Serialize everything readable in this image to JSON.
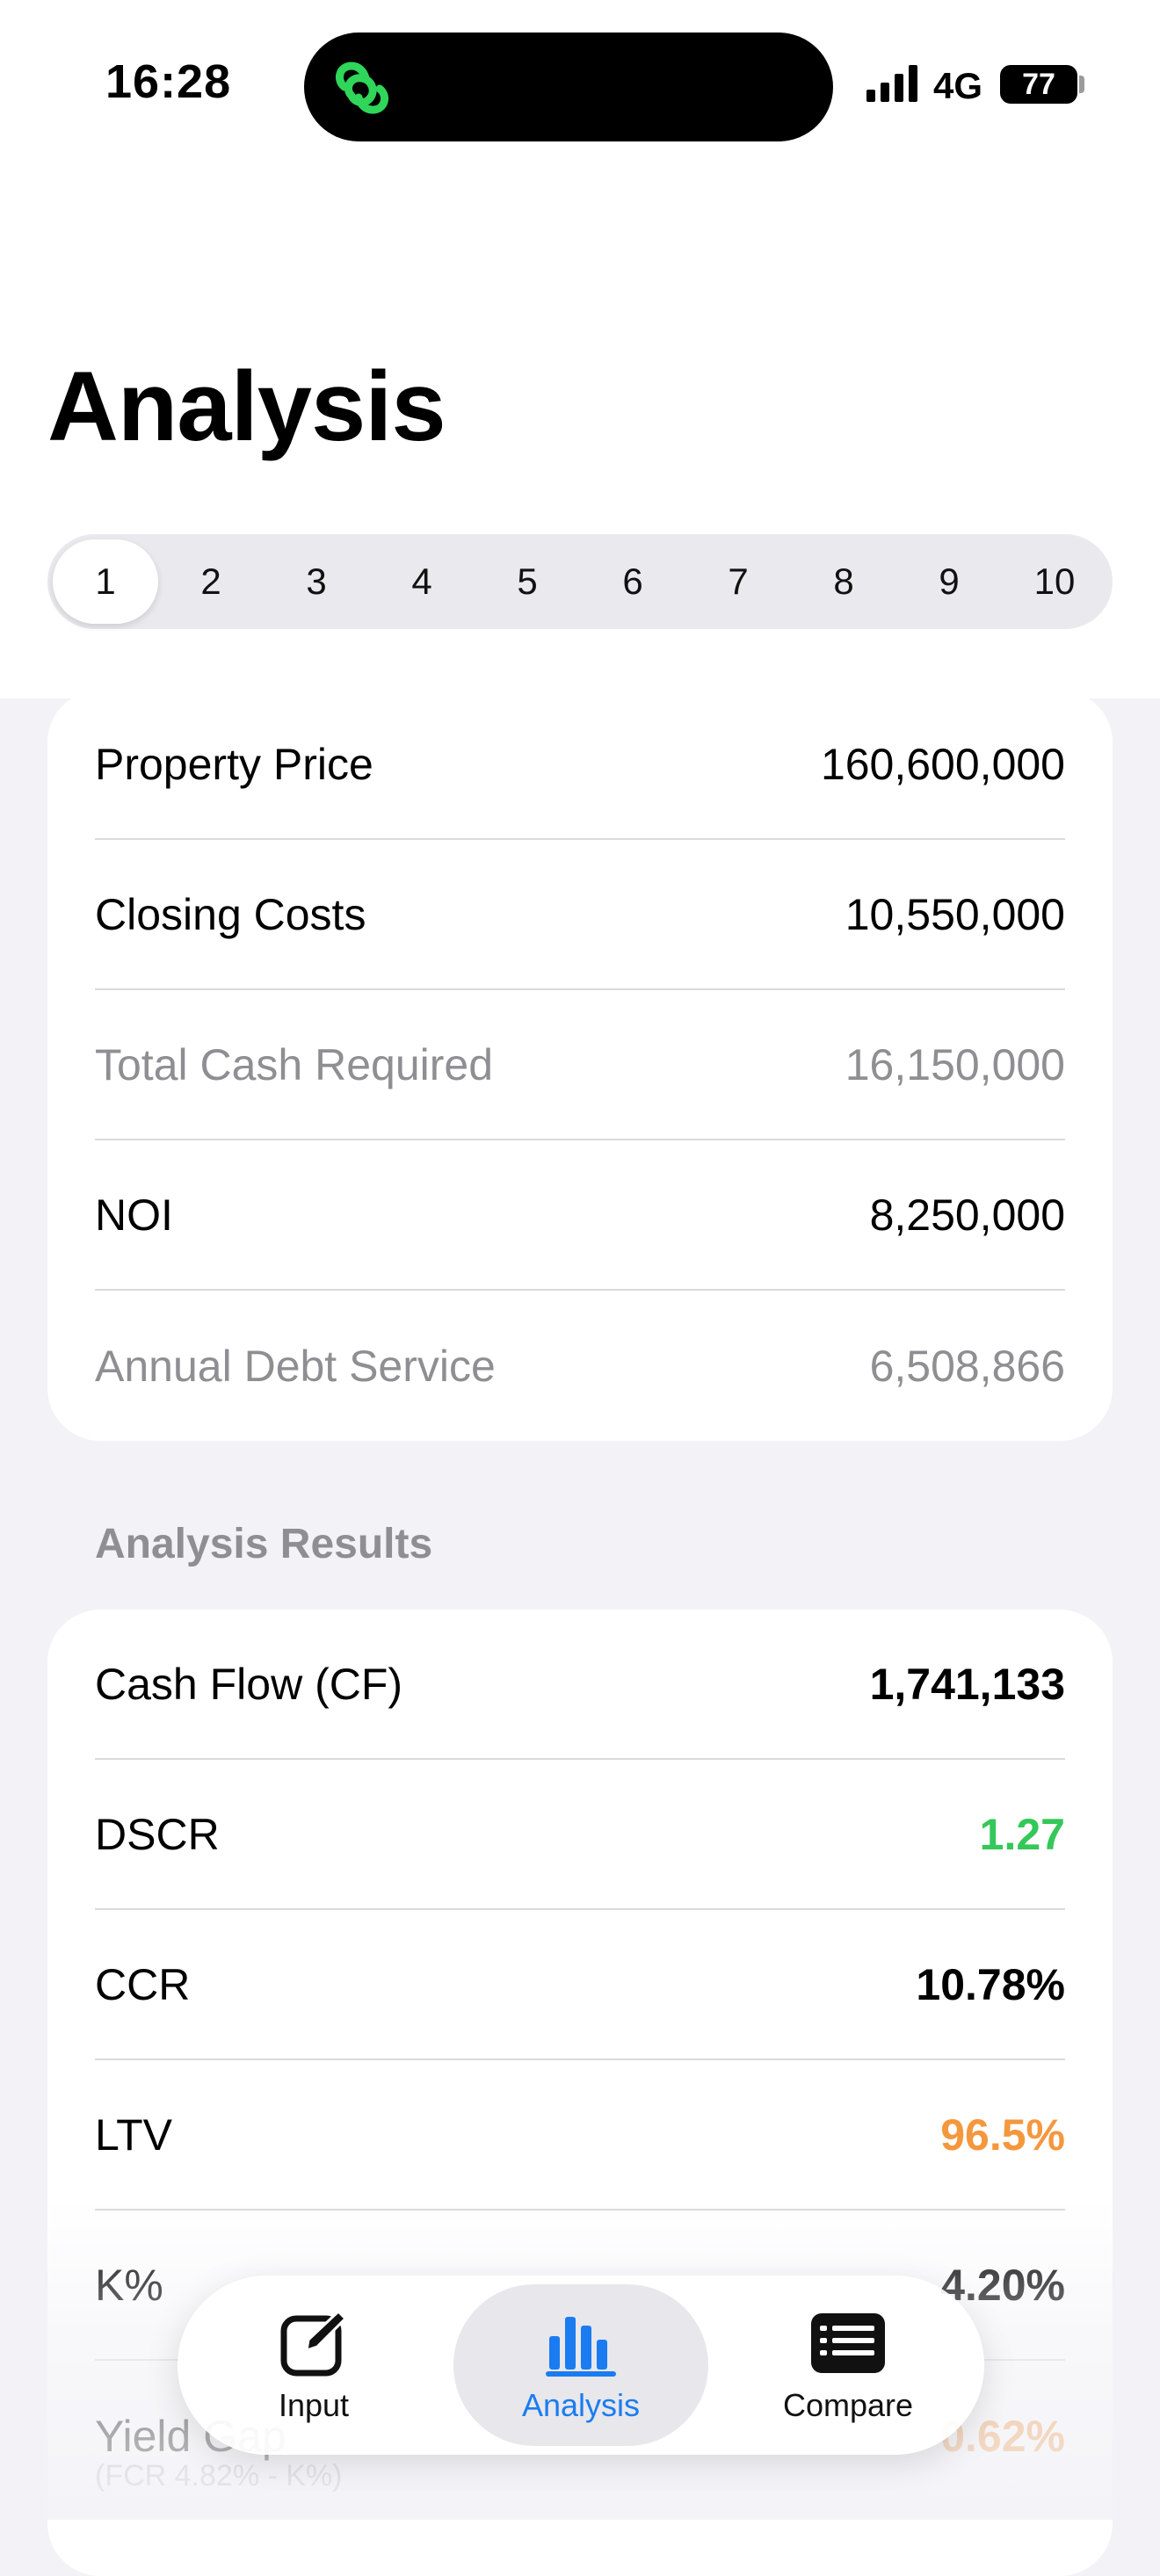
{
  "status_bar": {
    "time": "16:28",
    "network": "4G",
    "battery": "77"
  },
  "page": {
    "title": "Analysis"
  },
  "segments": [
    "1",
    "2",
    "3",
    "4",
    "5",
    "6",
    "7",
    "8",
    "9",
    "10"
  ],
  "selected_segment": "1",
  "summary_rows": [
    {
      "label": "Property Price",
      "value": "160,600,000"
    },
    {
      "label": "Closing Costs",
      "value": "10,550,000"
    },
    {
      "label": "Total Cash Required",
      "value": "16,150,000"
    },
    {
      "label": "NOI",
      "value": "8,250,000"
    },
    {
      "label": "Annual Debt Service",
      "value": "6,508,866"
    }
  ],
  "results": {
    "header": "Analysis Results",
    "rows": [
      {
        "label": "Cash Flow (CF)",
        "value": "1,741,133"
      },
      {
        "label": "DSCR",
        "value": "1.27"
      },
      {
        "label": "CCR",
        "value": "10.78%"
      },
      {
        "label": "LTV",
        "value": "96.5%"
      },
      {
        "label": "K%",
        "value": "4.20%"
      },
      {
        "label": "Yield Gap",
        "sub": "(FCR 4.82% - K%)",
        "value": "0.62%"
      }
    ]
  },
  "colors": {
    "accent": "#1a7cf0",
    "good": "#34c759",
    "warning": "#f5973d",
    "muted": "#8e8e93"
  },
  "tabbar": {
    "tabs": [
      {
        "label": "Input",
        "icon": "edit-icon"
      },
      {
        "label": "Analysis",
        "icon": "bar-chart-icon"
      },
      {
        "label": "Compare",
        "icon": "list-icon"
      }
    ]
  }
}
